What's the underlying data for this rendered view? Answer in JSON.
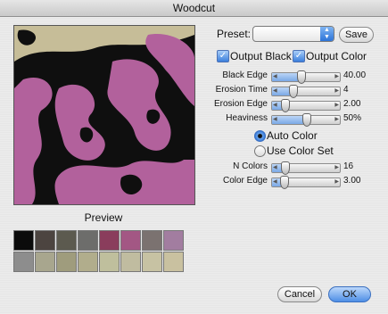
{
  "window": {
    "title": "Woodcut"
  },
  "preview": {
    "label": "Preview"
  },
  "swatches": [
    "#0b0b0b",
    "#4c4440",
    "#5c5a4f",
    "#6d6d6b",
    "#8a3d5c",
    "#a35784",
    "#7b7270",
    "#a27da0",
    "#8d8d8d",
    "#a8a68e",
    "#9f9c7d",
    "#b1ad8c",
    "#bfbf9d",
    "#c0bca0",
    "#c7c2a3",
    "#c9c1a0"
  ],
  "preset": {
    "label": "Preset:",
    "value": "",
    "save_label": "Save"
  },
  "output_black": {
    "label": "Output Black",
    "checked": true
  },
  "output_color": {
    "label": "Output Color",
    "checked": true
  },
  "sliders": {
    "black_edge": {
      "label": "Black Edge",
      "value": "40.00",
      "fraction": 0.4
    },
    "erosion_time": {
      "label": "Erosion Time",
      "value": "4",
      "fraction": 0.24
    },
    "erosion_edge": {
      "label": "Erosion Edge",
      "value": "2.00",
      "fraction": 0.08
    },
    "heaviness": {
      "label": "Heaviness",
      "value": "50%",
      "fraction": 0.5
    },
    "n_colors": {
      "label": "N Colors",
      "value": "16",
      "fraction": 0.08
    },
    "color_edge": {
      "label": "Color Edge",
      "value": "3.00",
      "fraction": 0.06
    }
  },
  "auto_color": {
    "label": "Auto Color",
    "selected": true
  },
  "use_color_set": {
    "label": "Use Color Set",
    "selected": false
  },
  "buttons": {
    "cancel": "Cancel",
    "ok": "OK"
  }
}
